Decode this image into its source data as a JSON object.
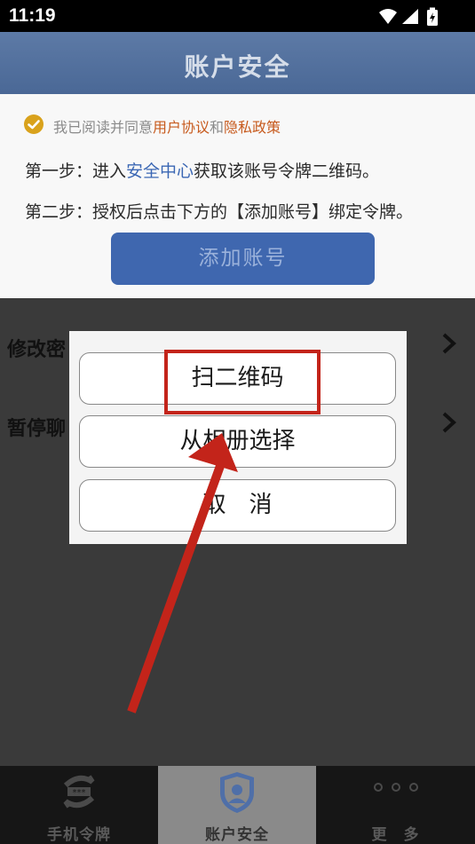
{
  "status_bar": {
    "time": "11:19"
  },
  "header": {
    "title": "账户安全"
  },
  "agreement": {
    "prefix": "我已阅读并同意",
    "user_agreement": "用户协议",
    "and": "和",
    "privacy_policy": "隐私政策"
  },
  "steps": {
    "step1_prefix": "第一步：进入",
    "step1_link": "安全中心",
    "step1_suffix": "获取该账号令牌二维码。",
    "step2": "第二步：授权后点击下方的【添加账号】绑定令牌。"
  },
  "add_account_label": "添加账号",
  "menu": [
    {
      "label": "修改密"
    },
    {
      "label": "暂停聊"
    }
  ],
  "dialog": {
    "scan_qr": "扫二维码",
    "from_album": "从相册选择",
    "cancel": "取　消"
  },
  "bottom_nav": [
    {
      "label": "手机令牌",
      "icon": "token-icon"
    },
    {
      "label": "账户安全",
      "icon": "shield-user-icon",
      "active": true
    },
    {
      "label": "更　多",
      "icon": "more-dots-icon"
    }
  ],
  "colors": {
    "header": "#4a6896",
    "link_orange": "#c75a1d",
    "link_blue": "#3b67b4",
    "highlight": "#c3241a"
  }
}
